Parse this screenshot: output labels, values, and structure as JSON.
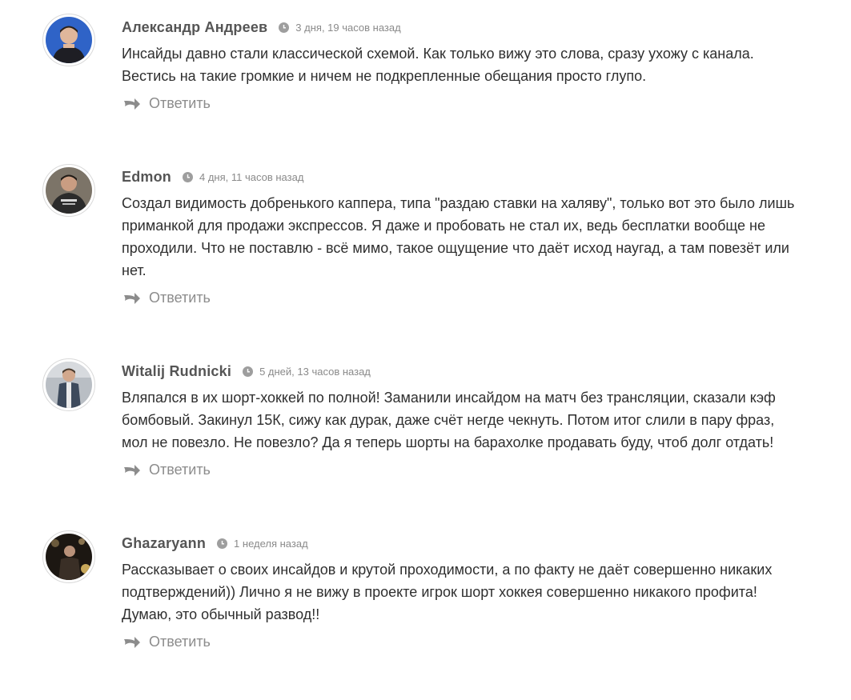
{
  "comments": [
    {
      "author": "Александр Андреев",
      "date": "3 дня, 19 часов назад",
      "text": "Инсайды давно стали классической схемой. Как только вижу это слова, сразу ухожу с канала.\nВестись на такие громкие и ничем не подкрепленные обещания просто глупо.",
      "reply_label": "Ответить",
      "avatar_icon": "avatar-photo",
      "accent": "#2f63c7"
    },
    {
      "author": "Edmon",
      "date": "4 дня, 11 часов назад",
      "text": "Создал видимость добренького каппера, типа \"раздаю ставки на халяву\", только вот это было лишь\nприманкой для продажи экспрессов. Я даже и пробовать не стал их, ведь бесплатки вообще не\nпроходили. Что не поставлю - всё мимо, такое ощущение что даёт исход наугад, а там повезёт или\nнет.",
      "reply_label": "Ответить",
      "avatar_icon": "avatar-photo",
      "accent": "#3b3b3b"
    },
    {
      "author": "Witalij Rudnicki",
      "date": "5 дней, 13 часов назад",
      "text": "Вляпался в их шорт-хоккей по полной! Заманили инсайдом на матч без трансляции, сказали кэф\nбомбовый. Закинул 15К, сижу как дурак, даже счёт негде чекнуть. Потом итог слили в пару фраз,\nмол не повезло. Не повезло? Да я теперь шорты на барахолке продавать буду, чтоб долг отдать!",
      "reply_label": "Ответить",
      "avatar_icon": "avatar-photo",
      "accent": "#8a8f96"
    },
    {
      "author": "Ghazaryann",
      "date": "1 неделя назад",
      "text": "Рассказывает о своих инсайдов и крутой проходимости, а по факту не даёт совершенно никаких\nподтверждений)) Лично я не вижу в проекте игрок шорт хоккея совершенно никакого профита!\nДумаю, это обычный развод!!",
      "reply_label": "Ответить",
      "avatar_icon": "avatar-photo",
      "accent": "#2a2118"
    }
  ],
  "icons": {
    "date": "clock-icon",
    "reply": "reply-arrow-icon"
  }
}
